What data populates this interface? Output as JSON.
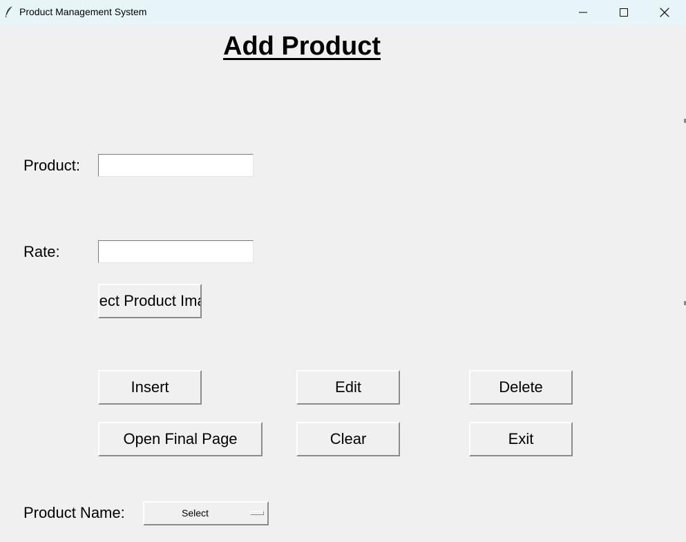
{
  "window": {
    "title": "Product Management System",
    "icon": "feather-icon",
    "controls": [
      "minimize-icon",
      "maximize-icon",
      "close-icon"
    ]
  },
  "form": {
    "heading": "Add Product",
    "product_label": "Product:",
    "product_value": "",
    "rate_label": "Rate:",
    "rate_value": "",
    "select_image_button": "Select Product Image",
    "product_name_label": "Product Name:",
    "product_name_selected": "Select"
  },
  "buttons": {
    "insert": "Insert",
    "edit": "Edit",
    "delete": "Delete",
    "open_final_page": "Open Final Page",
    "clear": "Clear",
    "exit": "Exit"
  },
  "colors": {
    "window_bg": "#f0f0f0",
    "titlebar_bg": "#e7f4f8"
  }
}
